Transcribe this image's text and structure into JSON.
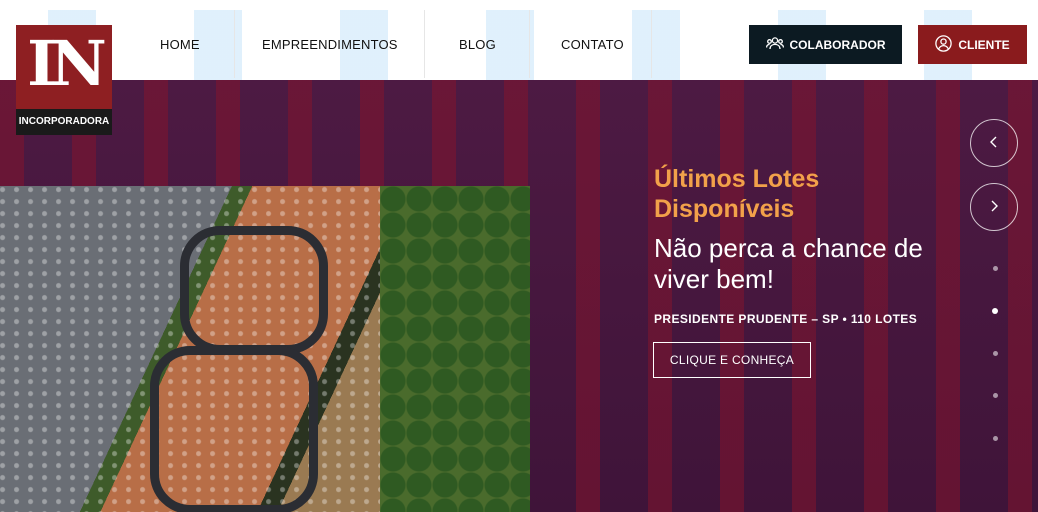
{
  "logo": {
    "letters": "IN",
    "tag": "INCORPORADORA"
  },
  "nav": [
    {
      "label": "HOME"
    },
    {
      "label": "EMPREENDIMENTOS"
    },
    {
      "label": "BLOG"
    },
    {
      "label": "CONTATO"
    }
  ],
  "buttons": {
    "colaborador": "COLABORADOR",
    "cliente": "CLIENTE"
  },
  "hero": {
    "title": "Últimos Lotes Disponíveis",
    "subtitle": "Não perca a chance de viver bem!",
    "location": "PRESIDENTE PRUDENTE – SP • 110 LOTES",
    "cta": "CLIQUE E CONHEÇA"
  },
  "slider": {
    "prev_icon": "chevron-left-icon",
    "next_icon": "chevron-right-icon",
    "slide_count": 5,
    "active_slide": 2
  },
  "colors": {
    "brand": "#8e1f22",
    "dark": "#0c1a22",
    "hero_bg": "#4d1a43",
    "accent": "#f2a14a"
  }
}
